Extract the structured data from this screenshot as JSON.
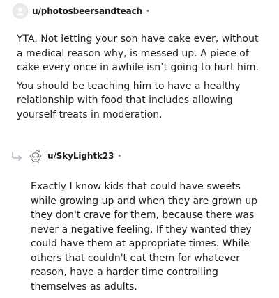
{
  "comments": [
    {
      "username": "u/photosbeersandteach",
      "separator": "•",
      "avatar_icon": "default-avatar-icon",
      "paragraphs": [
        "YTA. Not letting your son have cake ever, without a medical reason why, is messed up. A piece of cake every once in awhile isn’t going to hurt him.",
        "You should be teaching him to have a healthy relationship with food that includes allowing yourself treats in moderation."
      ]
    },
    {
      "username": "u/SkyLightk23",
      "separator": "•",
      "avatar_icon": "snoo-avatar-icon",
      "reply_icon": "reply-arrow-icon",
      "paragraphs": [
        "Exactly I know kids that could have sweets while growing up and when they are grown up they don't crave for them, because there was never a negative feeling. If they wanted they could have them at appropriate times. While others that couldn't eat them for whatever reason, have a harder time controlling themselves as adults."
      ]
    }
  ],
  "colors": {
    "text": "#1c1c1c",
    "meta": "#7c7c7c",
    "avatar_bg": "#e9ebed",
    "reply_arrow": "#b8bcc0"
  }
}
